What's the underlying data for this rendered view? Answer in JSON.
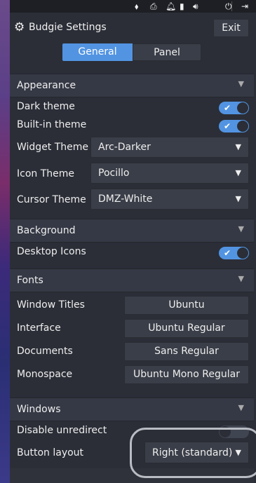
{
  "app": {
    "title": "Budgie Settings",
    "exit_label": "Exit"
  },
  "tabs": [
    {
      "label": "General",
      "active": true
    },
    {
      "label": "Panel",
      "active": false
    }
  ],
  "tray": {
    "icons": [
      "network-icon",
      "printer-icon",
      "notification-bell-icon",
      "battery-icon",
      "volume-icon",
      "power-icon",
      "logout-icon"
    ]
  },
  "sections": {
    "appearance": {
      "title": "Appearance",
      "dark_theme": {
        "label": "Dark theme",
        "on": true
      },
      "builtin_theme": {
        "label": "Built-in theme",
        "on": true
      },
      "widget_theme": {
        "label": "Widget Theme",
        "value": "Arc-Darker"
      },
      "icon_theme": {
        "label": "Icon Theme",
        "value": "Pocillo"
      },
      "cursor_theme": {
        "label": "Cursor Theme",
        "value": "DMZ-White"
      }
    },
    "background": {
      "title": "Background",
      "desktop_icons": {
        "label": "Desktop Icons",
        "on": true
      }
    },
    "fonts": {
      "title": "Fonts",
      "window_titles": {
        "label": "Window Titles",
        "value": "Ubuntu"
      },
      "interface": {
        "label": "Interface",
        "value": "Ubuntu Regular"
      },
      "documents": {
        "label": "Documents",
        "value": "Sans Regular"
      },
      "monospace": {
        "label": "Monospace",
        "value": "Ubuntu Mono Regular"
      }
    },
    "windows": {
      "title": "Windows",
      "disable_unredirect": {
        "label": "Disable unredirect",
        "on": false
      },
      "button_layout": {
        "label": "Button layout",
        "value": "Right (standard)"
      }
    }
  },
  "colors": {
    "accent": "#5294e2",
    "window_bg": "#2b2e37",
    "header_bg": "#353945"
  }
}
